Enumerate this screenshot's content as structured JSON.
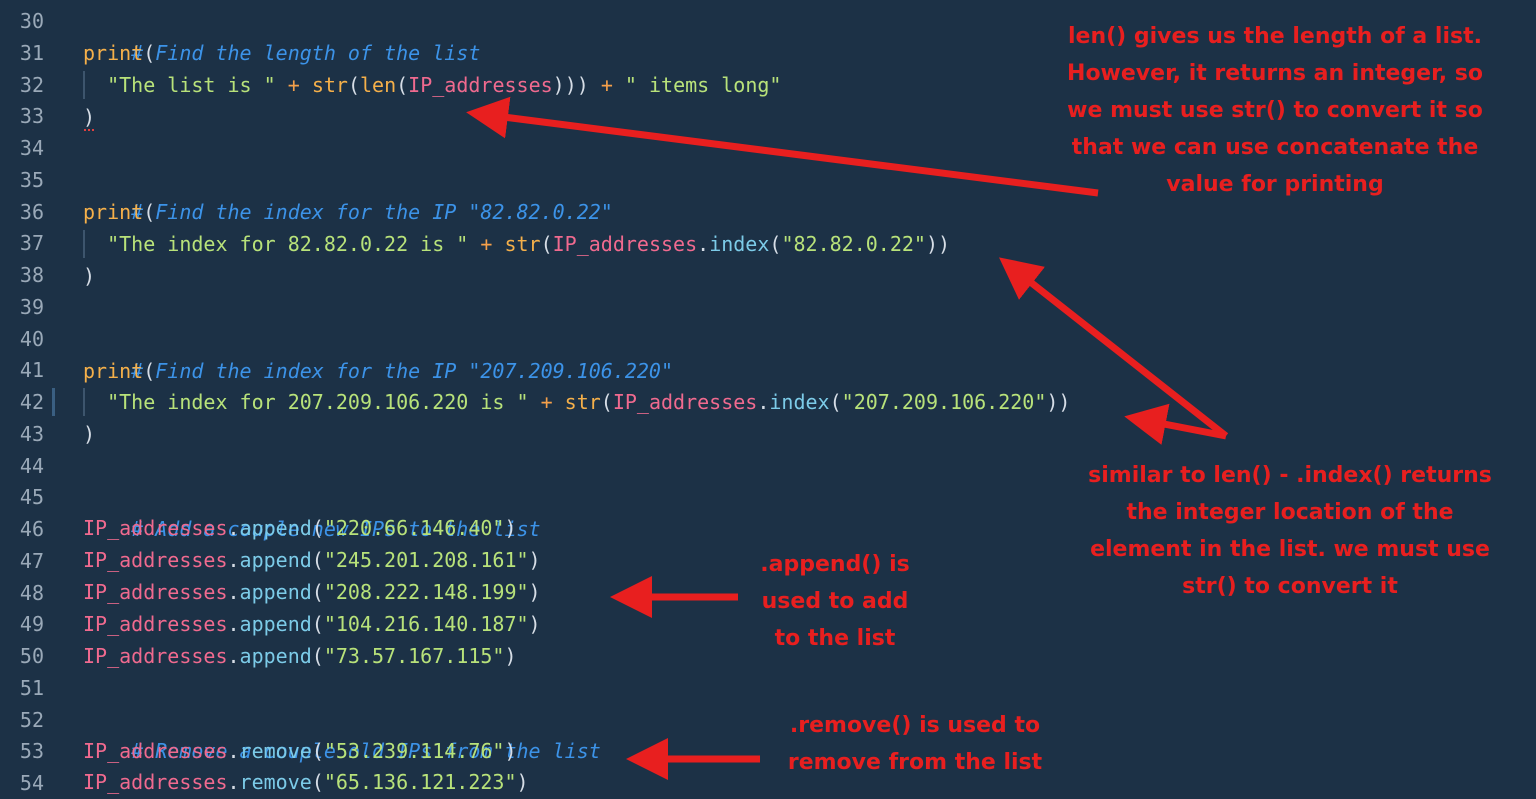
{
  "editor": {
    "line_numbers": [
      "30",
      "31",
      "32",
      "33",
      "34",
      "35",
      "36",
      "37",
      "38",
      "39",
      "40",
      "41",
      "42",
      "43",
      "44",
      "45",
      "46",
      "47",
      "48",
      "49",
      "50",
      "51",
      "52",
      "53",
      "54"
    ]
  },
  "code": {
    "l30": "# Find the length of the list",
    "l31_fn": "print",
    "l31_paren": "(",
    "l32_str1": "\"The list is \"",
    "l32_plus1": "+",
    "l32_str_fn": "str",
    "l32_p1": "(",
    "l32_len": "len",
    "l32_p2": "(",
    "l32_var": "IP_addresses",
    "l32_p3": ")))",
    "l32_plus2": "+",
    "l32_str2": "\" items long\"",
    "l33": ")",
    "l35": "# Find the index for the IP \"82.82.0.22\"",
    "l36_fn": "print",
    "l36_paren": "(",
    "l37_str1": "\"The index for 82.82.0.22 is \"",
    "l37_plus": "+",
    "l37_str_fn": "str",
    "l37_p1": "(",
    "l37_var": "IP_addresses",
    "l37_dot": ".",
    "l37_meth": "index",
    "l37_p2": "(",
    "l37_arg": "\"82.82.0.22\"",
    "l37_p3": "))",
    "l38": ")",
    "l40": "# Find the index for the IP \"207.209.106.220\"",
    "l41_fn": "print",
    "l41_paren": "(",
    "l42_str1": "\"The index for 207.209.106.220 is \"",
    "l42_plus": "+",
    "l42_str_fn": "str",
    "l42_p1": "(",
    "l42_var": "IP_addresses",
    "l42_dot": ".",
    "l42_meth": "index",
    "l42_p2": "(",
    "l42_arg": "\"207.209.106.220\"",
    "l42_p3": "))",
    "l43": ")",
    "l45": "# Add a couple new IPs to the list",
    "l52": "# Remove a couple old IPs from the list",
    "var_name": "IP_addresses",
    "dot": ".",
    "append": "append",
    "remove": "remove",
    "open": "(",
    "close": ")",
    "append_args": [
      "\"220.66.146.40\"",
      "\"245.201.208.161\"",
      "\"208.222.148.199\"",
      "\"104.216.140.187\"",
      "\"73.57.167.115\""
    ],
    "remove_args": [
      "\"53.239.114.76\"",
      "\"65.136.121.223\""
    ]
  },
  "annotations": {
    "len_note": "len() gives us the length of a list.\nHowever, it returns an integer, so\nwe must use str() to convert it so\nthat we can use concatenate the\nvalue for printing",
    "index_note": "similar to len() - .index() returns\nthe integer location of the\nelement in the list. we must use\nstr() to convert it",
    "append_note": ".append() is\nused to add\nto the list",
    "remove_note": ".remove() is used to\nremove from the list"
  },
  "colors": {
    "background": "#1c3146",
    "comment": "#3c93e8",
    "function": "#f5b04a",
    "string": "#b8e27a",
    "variable": "#f06a8f",
    "method": "#7ccbe8",
    "annotation": "#e81f1f"
  }
}
